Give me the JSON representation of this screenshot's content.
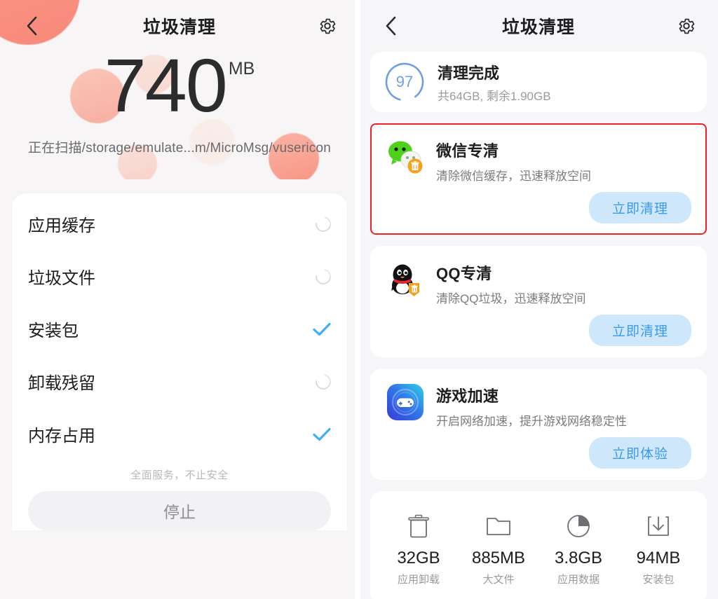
{
  "left": {
    "header": {
      "title": "垃圾清理",
      "back_icon": "chevron-left-icon",
      "settings_icon": "gear-icon"
    },
    "scan": {
      "amount": "740",
      "unit": "MB",
      "path_text": "正在扫描/storage/emulate...m/MicroMsg/vusericon"
    },
    "scan_items": [
      {
        "label": "应用缓存",
        "state": "scanning"
      },
      {
        "label": "垃圾文件",
        "state": "scanning"
      },
      {
        "label": "安装包",
        "state": "done"
      },
      {
        "label": "卸载残留",
        "state": "scanning"
      },
      {
        "label": "内存占用",
        "state": "done"
      }
    ],
    "tagline": "全面服务，不止安全",
    "stop_button": "停止"
  },
  "right": {
    "header": {
      "title": "垃圾清理",
      "back_icon": "chevron-left-icon",
      "settings_icon": "gear-icon"
    },
    "completion": {
      "score": "97",
      "title": "清理完成",
      "subtitle": "共64GB, 剩余1.90GB"
    },
    "features": [
      {
        "icon": "wechat-icon",
        "title": "微信专清",
        "subtitle": "清除微信缓存，迅速释放空间",
        "button": "立即清理",
        "highlighted": true
      },
      {
        "icon": "qq-icon",
        "title": "QQ专清",
        "subtitle": "清除QQ垃圾，迅速释放空间",
        "button": "立即清理",
        "highlighted": false
      },
      {
        "icon": "game-boost-icon",
        "title": "游戏加速",
        "subtitle": "开启网络加速，提升游戏网络稳定性",
        "button": "立即体验",
        "highlighted": false
      }
    ],
    "stats": [
      {
        "icon": "trash-icon",
        "value": "32GB",
        "label": "应用卸载"
      },
      {
        "icon": "folder-icon",
        "value": "885MB",
        "label": "大文件"
      },
      {
        "icon": "pie-icon",
        "value": "3.8GB",
        "label": "应用数据"
      },
      {
        "icon": "download-icon",
        "value": "94MB",
        "label": "安装包"
      }
    ]
  },
  "colors": {
    "accent_blue": "#3b9bf0",
    "button_bg": "#cfe7fb",
    "highlight_red": "#ef2222",
    "check_blue": "#3eaef5",
    "ring_blue": "#6f9fe0",
    "blob_pink": "#f98a7c"
  }
}
